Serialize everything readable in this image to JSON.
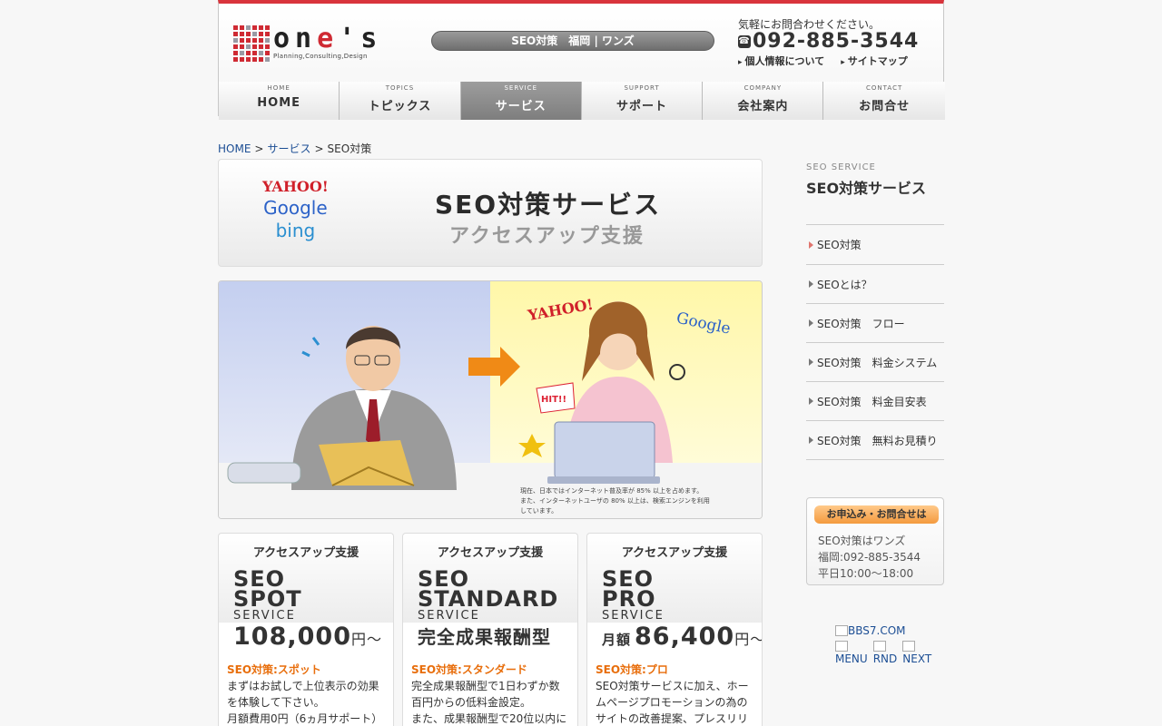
{
  "header": {
    "logo_word_a": "on",
    "logo_word_e": "e",
    "logo_word_b": "'s",
    "logo_tagline": "Planning,Consulting,Design",
    "tagline": "SEO対策　福岡 | ワンズ",
    "contact_lead": "気軽にお問合わせください。",
    "phone": "092-885-3544",
    "links": [
      "個人情報について",
      "サイトマップ"
    ]
  },
  "nav": [
    {
      "en": "HOME",
      "jp": "HOME"
    },
    {
      "en": "TOPICS",
      "jp": "トピックス"
    },
    {
      "en": "SERVICE",
      "jp": "サービス"
    },
    {
      "en": "SUPPORT",
      "jp": "サポート"
    },
    {
      "en": "COMPANY",
      "jp": "会社案内"
    },
    {
      "en": "CONTACT",
      "jp": "お問合せ"
    }
  ],
  "breadcrumb": {
    "home": "HOME",
    "service": "サービス",
    "sep": ">",
    "current": "SEO対策"
  },
  "banner": {
    "yahoo": "YAHOO!",
    "google": "Google",
    "bing": "bing",
    "title": "SEO対策サービス",
    "subtitle": "アクセスアップ支援"
  },
  "illustration": {
    "yahoo": "YAHOO!",
    "google": "Google",
    "hit": "HIT!!",
    "note": [
      "現在、日本ではインターネット普及率が 85% 以上を占めます。",
      "また、インターネットユーザの 80% 以上は、検索エンジンを利用",
      "しています。"
    ]
  },
  "cards": [
    {
      "top": "アクセスアップ支援",
      "big1": "SEO",
      "big2": "SPOT",
      "service": "SERVICE",
      "price_pre": "",
      "price": "108,000",
      "price_unit": "円～",
      "name": "SEO対策:スポット",
      "desc": [
        "まずはお試しで上位表示の効果",
        "を体験して下さい。",
        "月額費用0円（6ヵ月サポート）"
      ]
    },
    {
      "top": "アクセスアップ支援",
      "big1": "SEO",
      "big2": "STANDARD",
      "service": "SERVICE",
      "price_pre": "",
      "price": "完全成果報酬型",
      "price_unit": "",
      "name": "SEO対策:スタンダード",
      "desc": [
        "完全成果報酬型で1日わずか数",
        "百円からの低料金設定。",
        "また、成果報酬型で20位以内に"
      ]
    },
    {
      "top": "アクセスアップ支援",
      "big1": "SEO",
      "big2": "PRO",
      "service": "SERVICE",
      "price_pre": "月額",
      "price": "86,400",
      "price_unit": "円～",
      "name": "SEO対策:プロ",
      "desc": [
        "SEO対策サービスに加え、ホー",
        "ムページプロモーションの為の",
        "サイトの改善提案、プレスリリ"
      ]
    }
  ],
  "sidebar": {
    "en": "SEO SERVICE",
    "title": "SEO対策サービス",
    "items": [
      "SEO対策",
      "SEOとは？",
      "SEO対策　フロー",
      "SEO対策　料金システム",
      "SEO対策　料金目安表",
      "SEO対策　無料お見積り"
    ],
    "contact_head": "お申込み・お問合せは",
    "contact_lines": [
      "SEO対策はワンズ",
      "福岡:092-885-3544",
      "平日10:00～18:00"
    ],
    "bbs": "BBS7.COM",
    "mini_links": [
      "MENU",
      "RND",
      "NEXT"
    ]
  },
  "colors": {
    "accent": "#d9343c",
    "orange": "#e86e0c",
    "link": "#1c4e94",
    "nav_active": "#8a8a8a"
  }
}
